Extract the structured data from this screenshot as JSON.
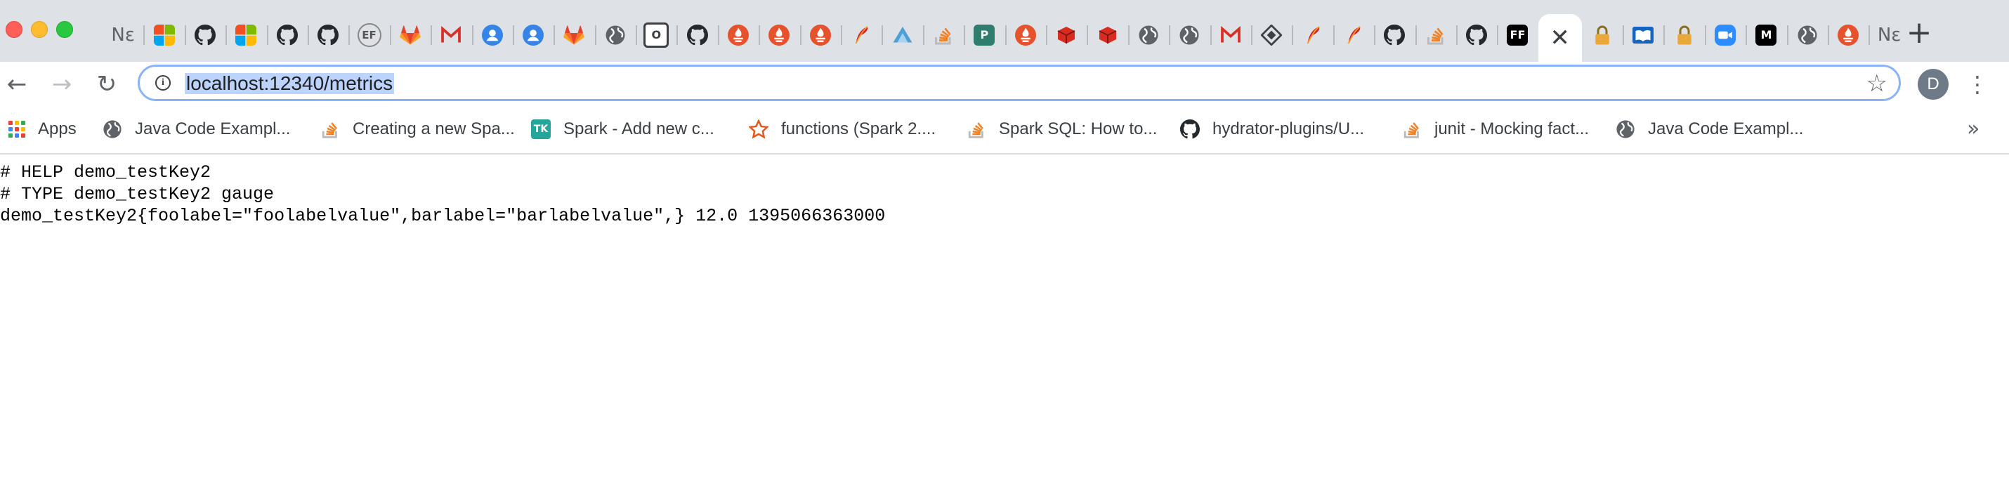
{
  "window": {
    "controls": [
      "close",
      "minimize",
      "zoom"
    ]
  },
  "tabs": [
    {
      "icon": "text",
      "text": "Nε"
    },
    {
      "icon": "microsoft-icon",
      "colors": [
        "#f25022",
        "#7fba00",
        "#00a4ef",
        "#ffb900"
      ]
    },
    {
      "icon": "github-icon"
    },
    {
      "icon": "microsoft-icon",
      "colors": [
        "#f25022",
        "#7fba00",
        "#00a4ef",
        "#ffb900"
      ]
    },
    {
      "icon": "github-icon"
    },
    {
      "icon": "github-icon"
    },
    {
      "icon": "ef-icon",
      "text": "EF"
    },
    {
      "icon": "gitlab-icon"
    },
    {
      "icon": "gmail-icon"
    },
    {
      "icon": "contacts-icon"
    },
    {
      "icon": "contacts-icon"
    },
    {
      "icon": "gitlab-icon"
    },
    {
      "icon": "globe-icon"
    },
    {
      "icon": "o-icon",
      "text": "O"
    },
    {
      "icon": "github-icon"
    },
    {
      "icon": "prometheus-icon"
    },
    {
      "icon": "prometheus-icon"
    },
    {
      "icon": "prometheus-icon"
    },
    {
      "icon": "feather-icon"
    },
    {
      "icon": "triangle-icon"
    },
    {
      "icon": "stackoverflow-icon"
    },
    {
      "icon": "p-icon",
      "text": "P"
    },
    {
      "icon": "prometheus-icon"
    },
    {
      "icon": "redis-icon"
    },
    {
      "icon": "redis-icon"
    },
    {
      "icon": "globe-icon"
    },
    {
      "icon": "globe-icon"
    },
    {
      "icon": "gmail-icon"
    },
    {
      "icon": "diamond-icon"
    },
    {
      "icon": "feather-icon"
    },
    {
      "icon": "feather-icon"
    },
    {
      "icon": "github-icon"
    },
    {
      "icon": "stackoverflow-icon"
    },
    {
      "icon": "github-icon"
    },
    {
      "icon": "ff-icon",
      "text": "FF"
    },
    {
      "icon": "close-icon",
      "active": true
    },
    {
      "icon": "lock-icon"
    },
    {
      "icon": "book-icon"
    },
    {
      "icon": "lock-icon"
    },
    {
      "icon": "zoom-icon"
    },
    {
      "icon": "medium-icon",
      "text": "M"
    },
    {
      "icon": "globe-icon"
    },
    {
      "icon": "prometheus-icon"
    },
    {
      "icon": "text",
      "text": "Nε"
    }
  ],
  "new_tab_label": "+",
  "toolbar": {
    "back": "←",
    "forward": "→",
    "reload": "↻",
    "url": "localhost:12340/metrics",
    "star": "☆",
    "profile_initial": "D",
    "menu": "⋮"
  },
  "bookmarks": [
    {
      "icon": "apps-icon",
      "label": "Apps"
    },
    {
      "icon": "globe-icon",
      "label": "Java Code Exampl..."
    },
    {
      "icon": "stackoverflow-icon",
      "label": "Creating a new Spa..."
    },
    {
      "icon": "tk-icon",
      "icon_text": "TK",
      "label": "Spark - Add new c..."
    },
    {
      "icon": "star-outline-icon",
      "label": "functions (Spark 2...."
    },
    {
      "icon": "stackoverflow-icon",
      "label": "Spark SQL: How to..."
    },
    {
      "icon": "github-icon",
      "label": "hydrator-plugins/U..."
    },
    {
      "icon": "stackoverflow-icon",
      "label": "junit - Mocking fact..."
    },
    {
      "icon": "globe-icon",
      "label": "Java Code Exampl..."
    }
  ],
  "bookmarks_more": "»",
  "content": {
    "lines": [
      "# HELP demo_testKey2",
      "# TYPE demo_testKey2 gauge",
      "demo_testKey2{foolabel=\"foolabelvalue\",barlabel=\"barlabelvalue\",} 12.0 1395066363000"
    ]
  },
  "colors": {
    "tabstrip_bg": "#dee1e6",
    "omnibox_border": "#8ab4f8",
    "url_selection": "#bcd3fb",
    "prometheus": "#e6522c",
    "redis": "#d82c20",
    "gitlab": "#fc6d26",
    "stackoverflow": "#f48024",
    "github": "#24292e"
  }
}
